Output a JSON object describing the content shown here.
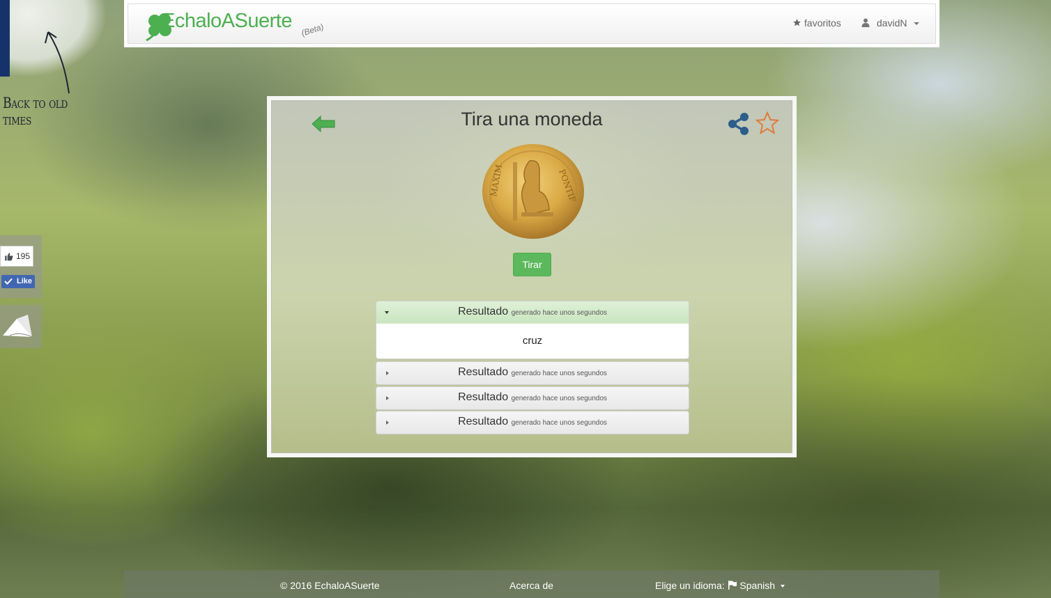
{
  "back_link": {
    "label": "Back to old times"
  },
  "header": {
    "brand": "EchaloASuerte",
    "beta": "(Beta)",
    "favorites": "favoritos",
    "user": "davidN"
  },
  "social": {
    "like_count": "195",
    "like_label": "Like"
  },
  "main": {
    "title": "Tira una moneda",
    "toss_button": "Tirar",
    "results": [
      {
        "title": "Resultado",
        "subtitle": "generado hace unos segundos",
        "value": "cruz",
        "expanded": true
      },
      {
        "title": "Resultado",
        "subtitle": "generado hace unos segundos",
        "expanded": false
      },
      {
        "title": "Resultado",
        "subtitle": "generado hace unos segundos",
        "expanded": false
      },
      {
        "title": "Resultado",
        "subtitle": "generado hace unos segundos",
        "expanded": false
      }
    ]
  },
  "footer": {
    "copyright": "© 2016 EchaloASuerte",
    "about": "Acerca de",
    "language_label": "Elige un idioma:",
    "language": "Spanish"
  },
  "colors": {
    "brand_green": "#4caf50",
    "button_green": "#5cb85c",
    "share_blue": "#2d5e8a",
    "star_orange": "#e07b39"
  }
}
